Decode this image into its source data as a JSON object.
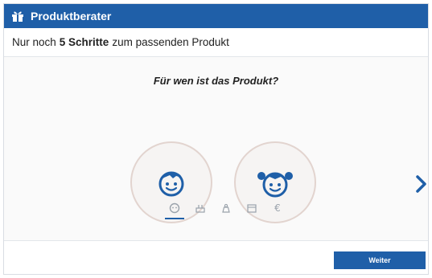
{
  "header": {
    "title": "Produktberater",
    "icon": "gift-icon"
  },
  "steps_bar": {
    "prefix": "Nur noch",
    "count_text": "5 Schritte",
    "suffix": "zum passenden Produkt"
  },
  "question": "Für wen ist das Produkt?",
  "choices": [
    {
      "name": "boy",
      "icon": "boy-face-icon"
    },
    {
      "name": "girl",
      "icon": "girl-face-icon"
    }
  ],
  "step_icons": [
    "face-icon",
    "age-icon",
    "weight-icon",
    "calendar-icon",
    "euro-icon"
  ],
  "step_labels": {
    "euro": "€"
  },
  "footer": {
    "next_label": "Weiter"
  },
  "colors": {
    "primary": "#1f5fa8",
    "circle_border": "#e2d4cf",
    "icon_gray": "#9aa2ab"
  }
}
